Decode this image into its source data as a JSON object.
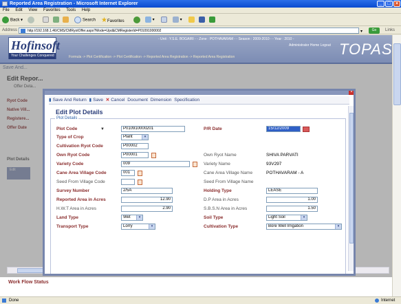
{
  "window": {
    "title": "Reported Area Registration - Microsoft Internet Explorer"
  },
  "menu": [
    "File",
    "Edit",
    "View",
    "Favorites",
    "Tools",
    "Help"
  ],
  "toolbar": {
    "back": "Back",
    "search": "Search",
    "favorites": "Favorites"
  },
  "address": {
    "label": "Address",
    "url": "http://192.168.1.46/CMS/CMRyotOffer.aspx?Mode=Upd&CMRegisterId=P01091000002",
    "go": "Go",
    "links": "Links"
  },
  "header": {
    "logo_main": "Hofinsoft",
    "logo_sub": "Your Challenges Conquered",
    "info": "- Unit : Y.S.E. BOGAIRI - - Zone : POTHAVARAM - - Season : 2009-2010 - - Year : 2010 -",
    "links": "Administrator   Home   Logout",
    "product": "TOPAS",
    "breadcrumb": "Formula -> Plot Certification -> Plot Certification -> Reported Area Registration -> Reported Area Registration"
  },
  "background": {
    "save": "Save And...",
    "title": "Edit Repor...",
    "offer_details": "Offer Deta...",
    "labels": [
      "Ryot Code",
      "Native Vill...",
      "Registere...",
      "Offer Date"
    ],
    "plot_details": "Plot Details",
    "grid_header": "Edit",
    "workflow": "Work Flow Status"
  },
  "dialog": {
    "toolbar": {
      "save_return": "Save And Return",
      "save": "Save",
      "cancel": "Cancel",
      "document": "Document",
      "dimension": "Dimension",
      "specification": "Specification"
    },
    "title": "Edit Plot Details",
    "legend": "Plot Details",
    "fields": {
      "plot_code": {
        "label": "Plot Code",
        "value": "P010910000201"
      },
      "pr_date": {
        "label": "P/R Date",
        "value": "15/12/2009"
      },
      "type_of_crop": {
        "label": "Type of Crop",
        "value": "Plant"
      },
      "cultivation_ryot_code": {
        "label": "Cultivation Ryot Code",
        "value": "P00002"
      },
      "own_ryot_code": {
        "label": "Own Ryot Code",
        "value": "P00001"
      },
      "own_ryot_name": {
        "label": "Own Ryot Name",
        "value": "SHIVA PARVATI"
      },
      "variety_code": {
        "label": "Variety Code",
        "value": "009"
      },
      "variety_name": {
        "label": "Variety Name",
        "value": "93V297"
      },
      "cane_area_village_code": {
        "label": "Cane Area Village Code",
        "value": "001"
      },
      "cane_area_village_name": {
        "label": "Cane Area Village Name",
        "value": "POTHAVARAM - A"
      },
      "seed_from_village_code": {
        "label": "Seed From Village Code",
        "value": ""
      },
      "seed_from_village_name": {
        "label": "Seed From Village Name",
        "value": ""
      },
      "survey_number": {
        "label": "Survey Number",
        "value": "2/5A"
      },
      "holding_type": {
        "label": "Holding Type",
        "value": "LEASE"
      },
      "reported_area": {
        "label": "Reported Area in Acres",
        "value": "12.90"
      },
      "dp_area": {
        "label": "D.P Area in Acres",
        "value": "1.00"
      },
      "hwt_area": {
        "label": "H.W.T Area in Acres",
        "value": "2.90"
      },
      "sbsn_area": {
        "label": "S.B.S.N Area in Acres",
        "value": "1.50"
      },
      "land_type": {
        "label": "Land Type",
        "value": "Wet"
      },
      "soil_type": {
        "label": "Soil Type",
        "value": "Light Soil"
      },
      "transport_type": {
        "label": "Transport Type",
        "value": "Lorry"
      },
      "cultivation_type": {
        "label": "Cultivation Type",
        "value": "Bore Well Irrigation"
      }
    }
  },
  "status": {
    "left": "Done",
    "right": "Internet"
  }
}
